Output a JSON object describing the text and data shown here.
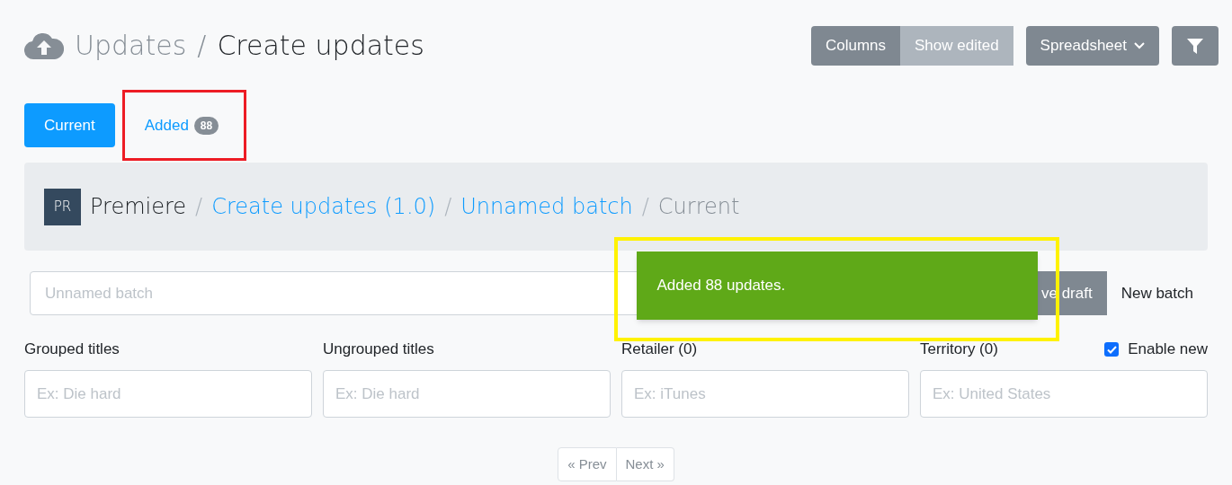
{
  "header": {
    "section": "Updates",
    "separator": "/",
    "title": "Create updates"
  },
  "toolbar": {
    "columns": "Columns",
    "show_edited": {
      "label": "Show edited",
      "selected": false
    },
    "view_menu": "Spreadsheet"
  },
  "tabs": [
    {
      "label": "Current",
      "selected": true
    },
    {
      "label": "Added",
      "selected": false,
      "badge": "88",
      "highlight": {
        "color": "#ed1c24"
      }
    }
  ],
  "breadcrumb": {
    "avatar": "PR",
    "items": [
      {
        "label": "Premiere",
        "kind": "text"
      },
      {
        "separator": "/",
        "label": "Create updates (1.0)",
        "kind": "link"
      },
      {
        "separator": "/",
        "label": "Unnamed batch",
        "kind": "link"
      },
      {
        "separator": "/",
        "label": "Current",
        "kind": "current"
      }
    ]
  },
  "batch": {
    "placeholder": "Unnamed batch",
    "save_button": "ve draft",
    "new_button": "New batch"
  },
  "toast": {
    "message": "Added 88 updates.",
    "highlight": {
      "color": "#fff200"
    }
  },
  "filters": [
    {
      "label": "Grouped titles",
      "placeholder": "Ex: Die hard"
    },
    {
      "label": "Ungrouped titles",
      "placeholder": "Ex: Die hard"
    },
    {
      "label": "Retailer (0)",
      "placeholder": "Ex: iTunes"
    },
    {
      "label": "Territory (0)",
      "placeholder": "Ex: United States"
    }
  ],
  "enable_new": {
    "label": "Enable new",
    "checked": true
  },
  "pagination": {
    "prev": "« Prev",
    "next": "Next »"
  }
}
